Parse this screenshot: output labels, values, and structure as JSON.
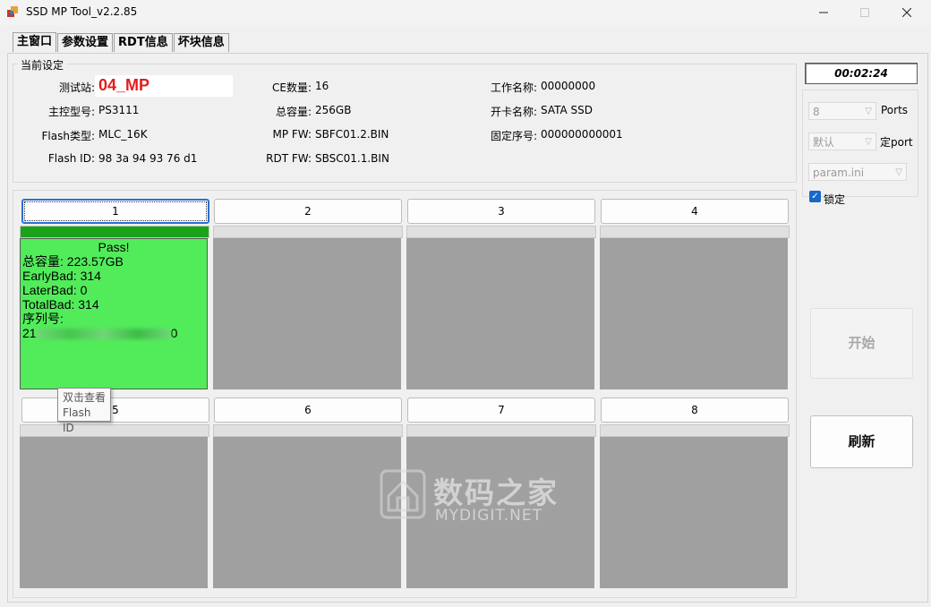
{
  "window": {
    "title": "SSD MP Tool_v2.2.85"
  },
  "tabs": [
    "主窗口",
    "参数设置",
    "RDT信息",
    "坏块信息"
  ],
  "settings": {
    "legend": "当前设定",
    "station_label": "测试站:",
    "station_value": "04_MP",
    "controller_label": "主控型号:",
    "controller_value": "PS3111",
    "flash_type_label": "Flash类型:",
    "flash_type_value": "MLC_16K",
    "flash_id_label": "Flash ID:",
    "flash_id_value": "98 3a 94 93 76 d1",
    "ce_label": "CE数量:",
    "ce_value": "16",
    "capacity_label": "总容量:",
    "capacity_value": "256GB",
    "mpfw_label": "MP FW:",
    "mpfw_value": "SBFC01.2.BIN",
    "rdtfw_label": "RDT FW:",
    "rdtfw_value": "SBSC01.1.BIN",
    "work_name_label": "工作名称:",
    "work_name_value": "00000000",
    "card_name_label": "开卡名称:",
    "card_name_value": "SATA SSD",
    "fixed_serial_label": "固定序号:",
    "fixed_serial_value": "000000000001"
  },
  "slots": [
    {
      "label": "1",
      "progress": 1.0
    },
    {
      "label": "2",
      "progress": 0
    },
    {
      "label": "3",
      "progress": 0
    },
    {
      "label": "4",
      "progress": 0
    },
    {
      "label": "5",
      "progress": 0
    },
    {
      "label": "6",
      "progress": 0
    },
    {
      "label": "7",
      "progress": 0
    },
    {
      "label": "8",
      "progress": 0
    }
  ],
  "slot1_result": {
    "status": "Pass!",
    "capacity": "总容量: 223.57GB",
    "early_bad": "EarlyBad: 314",
    "later_bad": "LaterBad: 0",
    "total_bad": "TotalBad: 314",
    "serial_label": "序列号:",
    "serial_start": "21",
    "serial_end": "0"
  },
  "tooltip": {
    "line1": "双击查看",
    "line2": "Flash ID"
  },
  "side": {
    "timer": "00:02:24",
    "ports_value": "8",
    "ports_label": "Ports",
    "port_mode_value": "默认",
    "port_mode_label": "定port",
    "param_file": "param.ini",
    "lock_label": "锁定",
    "start_label": "开始",
    "refresh_label": "刷新"
  },
  "watermark": {
    "cn": "数码之家",
    "en": "MYDIGIT.NET"
  },
  "colors": {
    "pass_green": "#52ec5a",
    "progress_green": "#19a319",
    "station_red": "#e51b1b",
    "idle_gray": "#a0a0a0"
  }
}
